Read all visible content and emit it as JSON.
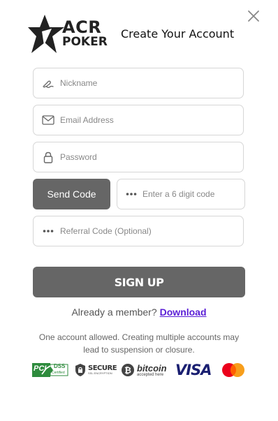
{
  "brand": {
    "line1": "ACR",
    "line2": "POKER"
  },
  "title": "Create Your Account",
  "fields": {
    "nickname_placeholder": "Nickname",
    "email_placeholder": "Email Address",
    "password_placeholder": "Password",
    "code_placeholder": "Enter a 6 digit code",
    "referral_placeholder": "Referral Code (Optional)"
  },
  "send_code_label": "Send Code",
  "signup_label": "SIGN UP",
  "member": {
    "text": "Already a member?",
    "link": "Download"
  },
  "note": "One account allowed. Creating multiple accounts may lead to suspension or closure.",
  "badges": {
    "pci": {
      "line1": "PCI",
      "line2": "DSS",
      "line3": "Certified"
    },
    "secure": {
      "line1": "SECURE",
      "line2": "SSL ENCRYPTION"
    },
    "bitcoin": {
      "line1": "bitcoin",
      "line2": "accepted here"
    },
    "visa": "VISA"
  },
  "colors": {
    "button": "#666666",
    "link": "#5a1ed6",
    "border": "#d6d6d6"
  }
}
